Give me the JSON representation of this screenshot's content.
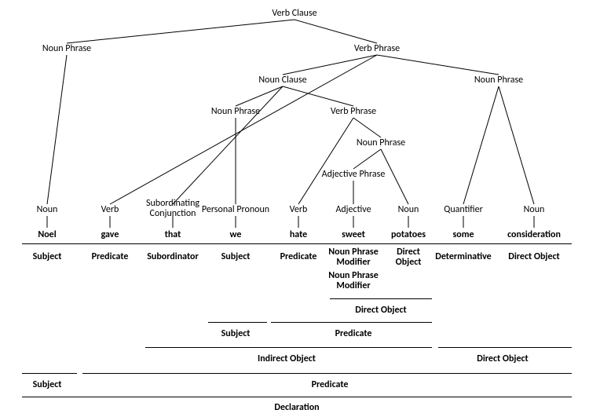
{
  "sentence": [
    "Noel",
    "gave",
    "that",
    "we",
    "hate",
    "sweet",
    "potatoes",
    "some",
    "consideration"
  ],
  "nodes": {
    "root": "Verb Clause",
    "np1": "Noun Phrase",
    "vp1": "Verb Phrase",
    "nc": "Noun Clause",
    "np2": "Noun Phrase",
    "np3": "Noun Phrase",
    "vp2": "Verb Phrase",
    "np4": "Noun Phrase",
    "ap": "Adjective Phrase",
    "t_noun": "Noun",
    "t_verb1": "Verb",
    "t_sub": "Subordinating",
    "t_sub2": "Conjunction",
    "t_pp": "Personal Pronoun",
    "t_verb2": "Verb",
    "t_adj": "Adjective",
    "t_noun2": "Noun",
    "t_q": "Quantifier",
    "t_noun3": "Noun"
  },
  "roles": {
    "r1": "Subject",
    "r2": "Predicate",
    "r3": "Subordinator",
    "r4": "Subject",
    "r5": "Predicate",
    "r6a": "Noun Phrase",
    "r6b": "Modifier",
    "r6c": "Noun Phrase",
    "r6d": "Modifier",
    "r7a": "Direct",
    "r7b": "Object",
    "r8": "Determinative",
    "r9": "Direct Object",
    "row_do": "Direct Object",
    "row_subj": "Subject",
    "row_pred": "Predicate",
    "row_io": "Indirect Object",
    "row_do2": "Direct Object",
    "row_s": "Subject",
    "row_p": "Predicate",
    "row_decl": "Declaration"
  },
  "chart_data": {
    "type": "tree",
    "title": "Syntax tree: Noel gave that we hate sweet potatoes some consideration",
    "tree": {
      "label": "Verb Clause",
      "role": "Declaration",
      "children": [
        {
          "label": "Noun Phrase",
          "role": "Subject",
          "children": [
            {
              "label": "Noun",
              "word": "Noel",
              "role": "Subject"
            }
          ]
        },
        {
          "label": "Verb Phrase",
          "role": "Predicate",
          "children": [
            {
              "label": "Verb",
              "word": "gave",
              "role": "Predicate"
            },
            {
              "label": "Noun Clause",
              "role": "Indirect Object",
              "children": [
                {
                  "label": "Subordinating Conjunction",
                  "word": "that",
                  "role": "Subordinator"
                },
                {
                  "label": "Noun Phrase",
                  "role": "Subject",
                  "children": [
                    {
                      "label": "Personal Pronoun",
                      "word": "we",
                      "role": "Subject"
                    }
                  ]
                },
                {
                  "label": "Verb Phrase",
                  "role": "Predicate",
                  "children": [
                    {
                      "label": "Verb",
                      "word": "hate",
                      "role": "Predicate"
                    },
                    {
                      "label": "Noun Phrase",
                      "role": "Direct Object",
                      "children": [
                        {
                          "label": "Adjective Phrase",
                          "role": "Noun Phrase Modifier",
                          "children": [
                            {
                              "label": "Adjective",
                              "word": "sweet",
                              "role": "Noun Phrase Modifier"
                            }
                          ]
                        },
                        {
                          "label": "Noun",
                          "word": "potatoes",
                          "role": "Direct Object"
                        }
                      ]
                    }
                  ]
                }
              ]
            },
            {
              "label": "Noun Phrase",
              "role": "Direct Object",
              "children": [
                {
                  "label": "Quantifier",
                  "word": "some",
                  "role": "Determinative"
                },
                {
                  "label": "Noun",
                  "word": "consideration",
                  "role": "Direct Object"
                }
              ]
            }
          ]
        }
      ]
    }
  }
}
